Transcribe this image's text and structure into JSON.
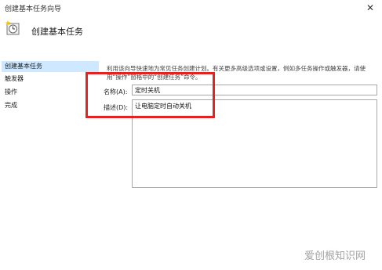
{
  "window": {
    "title": "创建基本任务向导"
  },
  "header": {
    "title": "创建基本任务"
  },
  "sidebar": {
    "items": [
      {
        "label": "创建基本任务"
      },
      {
        "label": "触发器"
      },
      {
        "label": "操作"
      },
      {
        "label": "完成"
      }
    ]
  },
  "main": {
    "description": "利用该向导快速地为常见任务创建计划。有关更多高级选项或设置，例如多任务操作或触发器，请使用“操作”窗格中的“创建任务”命令。",
    "name_label": "名称(A):",
    "name_value": "定时关机",
    "desc_label": "描述(D):",
    "desc_value": "让电脑定时自动关机"
  },
  "watermark": "爱创根知识网",
  "colors": {
    "highlight": "#e52222",
    "selected": "#cde8ff"
  }
}
